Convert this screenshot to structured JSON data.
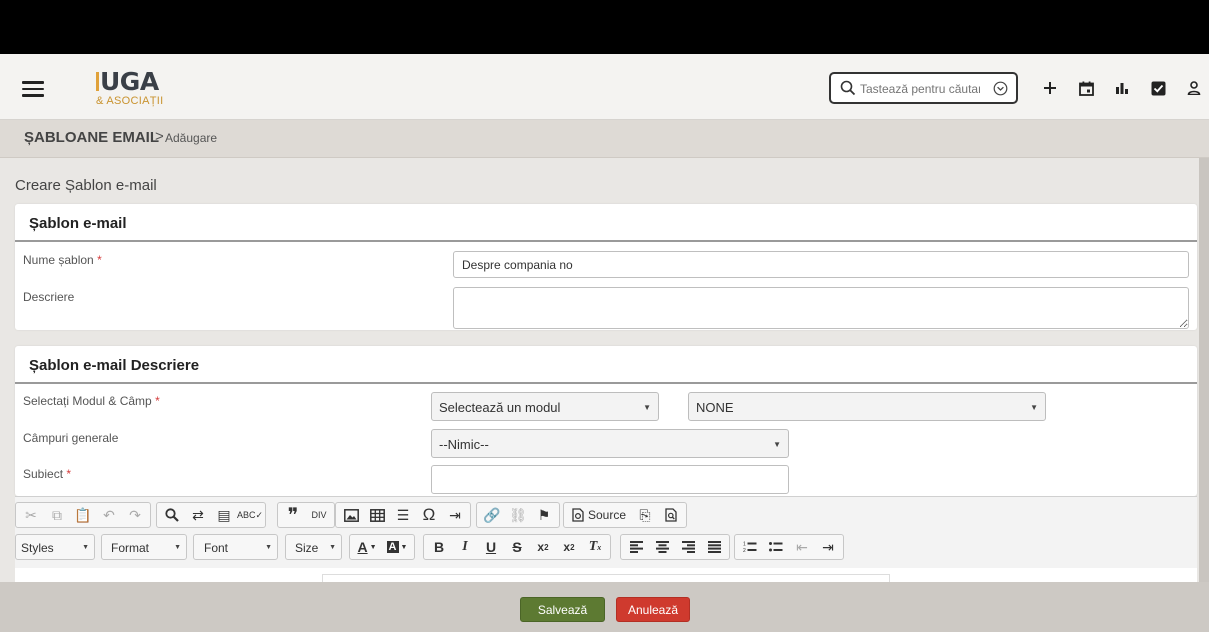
{
  "header": {
    "logo_main": "UGA",
    "logo_sub": "& ASOCIAȚII",
    "search_placeholder": "Tastează pentru căutare",
    "icons": [
      "menu-icon",
      "search-icon",
      "chevron-circle-icon",
      "plus-icon",
      "calendar-icon",
      "chart-icon",
      "checkbox-icon",
      "user-icon"
    ]
  },
  "breadcrumb": {
    "main": "ȘABLOANE EMAIL",
    "separator": ">",
    "current": "Adăugare"
  },
  "page_title": "Creare Șablon e-mail",
  "panel1": {
    "title": "Șablon e-mail",
    "name_label": "Nume șablon",
    "name_required": "*",
    "name_value": "Despre compania no",
    "description_label": "Descriere",
    "description_value": ""
  },
  "panel2": {
    "title": "Șablon e-mail Descriere",
    "module_label": "Selectați Modul & Câmp",
    "module_required": "*",
    "module_select": "Selectează un modul",
    "field_select": "NONE",
    "general_label": "Câmpuri generale",
    "general_select": "--Nimic--",
    "subject_label": "Subiect",
    "subject_required": "*",
    "subject_value": ""
  },
  "toolbar": {
    "source_label": "Source",
    "styles_label": "Styles",
    "format_label": "Format",
    "font_label": "Font",
    "size_label": "Size"
  },
  "footer": {
    "save_label": "Salvează",
    "cancel_label": "Anulează"
  },
  "colors": {
    "save": "#5d7a32",
    "cancel": "#cf3a2e",
    "logo_accent": "#c9932f",
    "required": "#d43b3b"
  }
}
